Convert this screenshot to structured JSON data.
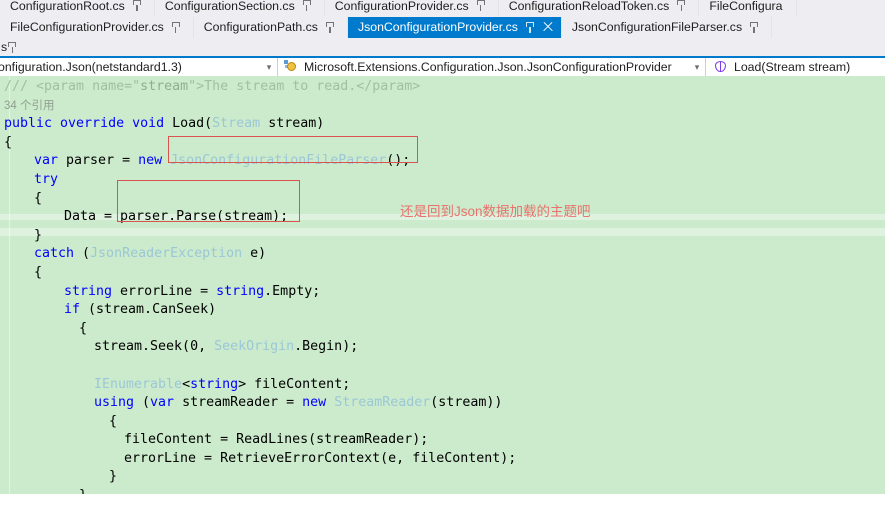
{
  "tabs": {
    "row1": [
      {
        "label": "ConfigurationRoot.cs",
        "pinned": true,
        "active": false
      },
      {
        "label": "ConfigurationSection.cs",
        "pinned": true,
        "active": false
      },
      {
        "label": "ConfigurationProvider.cs",
        "pinned": true,
        "active": false
      },
      {
        "label": "ConfigurationReloadToken.cs",
        "pinned": true,
        "active": false
      },
      {
        "label": "FileConfigura",
        "pinned": false,
        "active": false
      }
    ],
    "row2": [
      {
        "label": "FileConfigurationProvider.cs",
        "pinned": true,
        "active": false
      },
      {
        "label": "ConfigurationPath.cs",
        "pinned": true,
        "active": false
      },
      {
        "label": "JsonConfigurationProvider.cs",
        "pinned": true,
        "active": true,
        "close": "×"
      },
      {
        "label": "JsonConfigurationFileParser.cs",
        "pinned": true,
        "active": false
      }
    ],
    "row3_stub": "s"
  },
  "navbar": {
    "project": "onfiguration.Json(netstandard1.3)",
    "type": "Microsoft.Extensions.Configuration.Json.JsonConfigurationProvider",
    "member": "Load(Stream stream)",
    "caret": "▾"
  },
  "code": {
    "codelens": "34 个引用",
    "lines": [
      {
        "id": "l1",
        "indent": 0,
        "tokens": [
          {
            "t": "/// ",
            "c": "c-comment"
          },
          {
            "t": "<param name=\"",
            "c": "c-comment"
          },
          {
            "t": "stream",
            "c": "c-comment-text"
          },
          {
            "t": "\">The stream to read.</param>",
            "c": "c-comment"
          }
        ]
      },
      {
        "id": "l2",
        "indent": 0,
        "codelens": true
      },
      {
        "id": "l3",
        "indent": 0,
        "tokens": [
          {
            "t": "public override void ",
            "c": "c-kw"
          },
          {
            "t": "Load(",
            "c": "c-plain"
          },
          {
            "t": "Stream",
            "c": "c-type"
          },
          {
            "t": " stream)",
            "c": "c-plain"
          }
        ]
      },
      {
        "id": "l4",
        "indent": 0,
        "tokens": [
          {
            "t": "{",
            "c": "c-plain"
          }
        ]
      },
      {
        "id": "l5",
        "indent": 1,
        "tokens": [
          {
            "t": "var",
            "c": "c-kw"
          },
          {
            "t": " parser = ",
            "c": "c-plain"
          },
          {
            "t": "new",
            "c": "c-kw"
          },
          {
            "t": " ",
            "c": "c-plain"
          },
          {
            "t": "JsonConfigurationFileParser",
            "c": "c-type"
          },
          {
            "t": "();",
            "c": "c-plain"
          }
        ]
      },
      {
        "id": "l6",
        "indent": 1,
        "tokens": [
          {
            "t": "try",
            "c": "c-kw"
          }
        ]
      },
      {
        "id": "l7",
        "indent": 1,
        "tokens": [
          {
            "t": "{",
            "c": "c-plain"
          }
        ]
      },
      {
        "id": "l8",
        "indent": 2,
        "tokens": [
          {
            "t": "Data = parser.Parse(stream);",
            "c": "c-plain"
          }
        ]
      },
      {
        "id": "l9",
        "indent": 1,
        "tokens": [
          {
            "t": "}",
            "c": "c-plain"
          }
        ]
      },
      {
        "id": "l10",
        "indent": 1,
        "tokens": [
          {
            "t": "catch",
            "c": "c-kw"
          },
          {
            "t": " (",
            "c": "c-plain"
          },
          {
            "t": "JsonReaderException",
            "c": "c-type"
          },
          {
            "t": " e)",
            "c": "c-plain"
          }
        ]
      },
      {
        "id": "l11",
        "indent": 1,
        "tokens": [
          {
            "t": "{",
            "c": "c-plain"
          }
        ]
      },
      {
        "id": "l12",
        "indent": 2,
        "tokens": [
          {
            "t": "string",
            "c": "c-kw"
          },
          {
            "t": " errorLine = ",
            "c": "c-plain"
          },
          {
            "t": "string",
            "c": "c-kw"
          },
          {
            "t": ".Empty;",
            "c": "c-plain"
          }
        ]
      },
      {
        "id": "l13",
        "indent": 2,
        "tokens": [
          {
            "t": "if",
            "c": "c-kw"
          },
          {
            "t": " (stream.CanSeek)",
            "c": "c-plain"
          }
        ]
      },
      {
        "id": "l14",
        "indent": 2.5,
        "tokens": [
          {
            "t": "{",
            "c": "c-plain"
          }
        ]
      },
      {
        "id": "l15",
        "indent": 3,
        "tokens": [
          {
            "t": "stream.Seek(0, ",
            "c": "c-plain"
          },
          {
            "t": "SeekOrigin",
            "c": "c-type"
          },
          {
            "t": ".Begin);",
            "c": "c-plain"
          }
        ]
      },
      {
        "id": "l16",
        "indent": 0,
        "tokens": []
      },
      {
        "id": "l17",
        "indent": 3,
        "tokens": [
          {
            "t": "IEnumerable",
            "c": "c-type"
          },
          {
            "t": "<",
            "c": "c-plain"
          },
          {
            "t": "string",
            "c": "c-kw"
          },
          {
            "t": "> fileContent;",
            "c": "c-plain"
          }
        ]
      },
      {
        "id": "l18",
        "indent": 3,
        "tokens": [
          {
            "t": "using",
            "c": "c-kw"
          },
          {
            "t": " (",
            "c": "c-plain"
          },
          {
            "t": "var",
            "c": "c-kw"
          },
          {
            "t": " streamReader = ",
            "c": "c-plain"
          },
          {
            "t": "new",
            "c": "c-kw"
          },
          {
            "t": " ",
            "c": "c-plain"
          },
          {
            "t": "StreamReader",
            "c": "c-type"
          },
          {
            "t": "(stream))",
            "c": "c-plain"
          }
        ]
      },
      {
        "id": "l19",
        "indent": 3.5,
        "tokens": [
          {
            "t": "{",
            "c": "c-plain"
          }
        ]
      },
      {
        "id": "l20",
        "indent": 4,
        "tokens": [
          {
            "t": "fileContent = ReadLines(streamReader);",
            "c": "c-plain"
          }
        ]
      },
      {
        "id": "l21",
        "indent": 4,
        "tokens": [
          {
            "t": "errorLine = RetrieveErrorContext(e, fileContent);",
            "c": "c-plain"
          }
        ]
      },
      {
        "id": "l22",
        "indent": 3.5,
        "tokens": [
          {
            "t": "}",
            "c": "c-plain"
          }
        ]
      },
      {
        "id": "l23",
        "indent": 2.5,
        "tokens": [
          {
            "t": "}",
            "c": "c-plain"
          }
        ]
      }
    ]
  },
  "annotations": {
    "text1": "还是回到Json数据加载的主题吧",
    "box_color": "#d9534f",
    "text_color": "#e8726e"
  }
}
